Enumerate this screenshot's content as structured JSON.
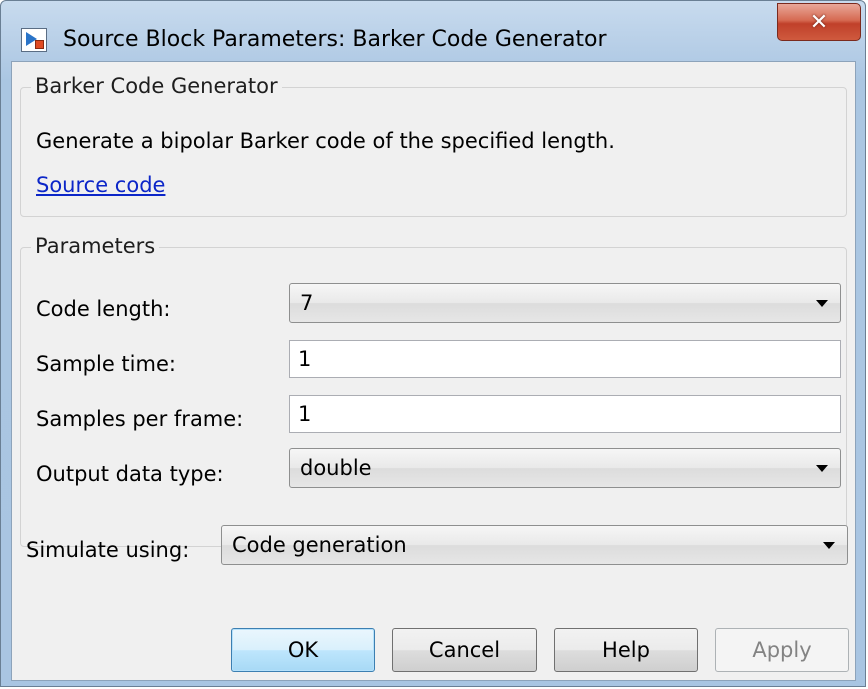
{
  "window": {
    "title": "Source Block Parameters: Barker Code Generator",
    "close_symbol": "✕"
  },
  "description_group": {
    "legend": "Barker Code Generator",
    "text": "Generate a bipolar Barker code of the specified length.",
    "link": "Source code"
  },
  "parameters_group": {
    "legend": "Parameters",
    "code_length_label": "Code length:",
    "code_length_value": "7",
    "sample_time_label": "Sample time:",
    "sample_time_value": "1",
    "samples_per_frame_label": "Samples per frame:",
    "samples_per_frame_value": "1",
    "output_data_type_label": "Output data type:",
    "output_data_type_value": "double"
  },
  "simulate": {
    "label": "Simulate using:",
    "value": "Code generation"
  },
  "buttons": {
    "ok": "OK",
    "cancel": "Cancel",
    "help": "Help",
    "apply": "Apply"
  },
  "colors": {
    "link": "#0c26c8",
    "close_button": "#c0402a",
    "default_button_border": "#3c7fb1"
  }
}
